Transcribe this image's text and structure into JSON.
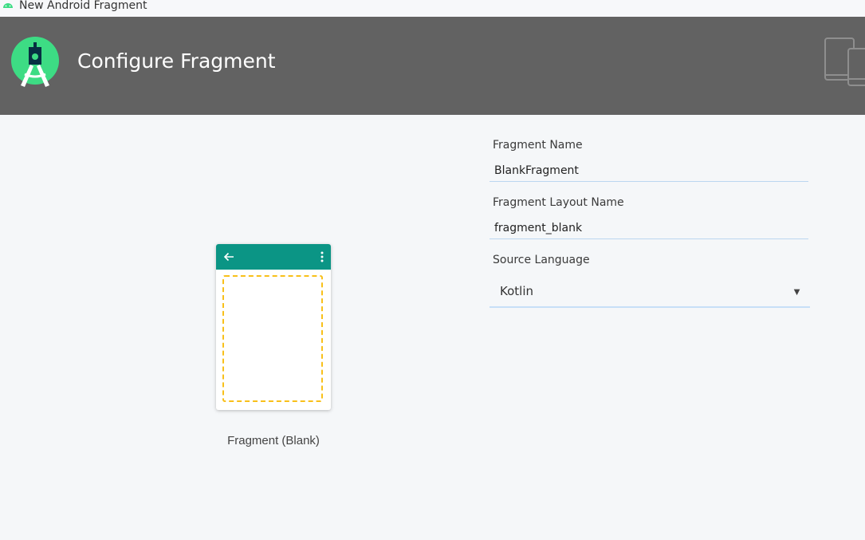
{
  "window": {
    "title": "New Android Fragment"
  },
  "header": {
    "title": "Configure Fragment"
  },
  "preview": {
    "caption": "Fragment (Blank)"
  },
  "form": {
    "fragment_name": {
      "label": "Fragment Name",
      "value": "BlankFragment"
    },
    "layout_name": {
      "label": "Fragment Layout Name",
      "value": "fragment_blank"
    },
    "source_language": {
      "label": "Source Language",
      "selected": "Kotlin"
    }
  },
  "colors": {
    "header_bg": "#626262",
    "appbar_teal": "#0b9585",
    "dashed_yellow": "#f8c01a",
    "android_green": "#3ddc84"
  },
  "icons": [
    "android-icon",
    "android-studio-logo-icon",
    "devices-icon",
    "back-arrow-icon",
    "overflow-menu-icon",
    "dropdown-caret-icon"
  ]
}
